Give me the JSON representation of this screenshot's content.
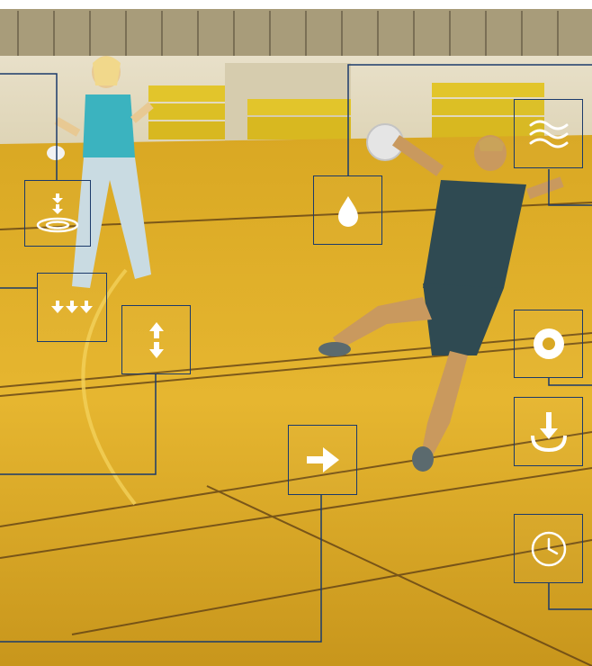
{
  "scene": {
    "description_free": true,
    "colors": {
      "floor": "#e3b52a",
      "floor_dark": "#c99a1c",
      "wall": "#e9e4d6",
      "mat": "#e4c92a",
      "line": "#1b3a6b",
      "icon": "#ffffff"
    }
  },
  "icons": [
    {
      "name": "landing-target-icon"
    },
    {
      "name": "triple-down-arrows-icon"
    },
    {
      "name": "up-down-arrows-icon"
    },
    {
      "name": "water-drop-icon"
    },
    {
      "name": "wind-waves-icon"
    },
    {
      "name": "circle-target-icon"
    },
    {
      "name": "down-arrow-cup-icon"
    },
    {
      "name": "clock-icon"
    },
    {
      "name": "right-arrow-icon"
    }
  ]
}
